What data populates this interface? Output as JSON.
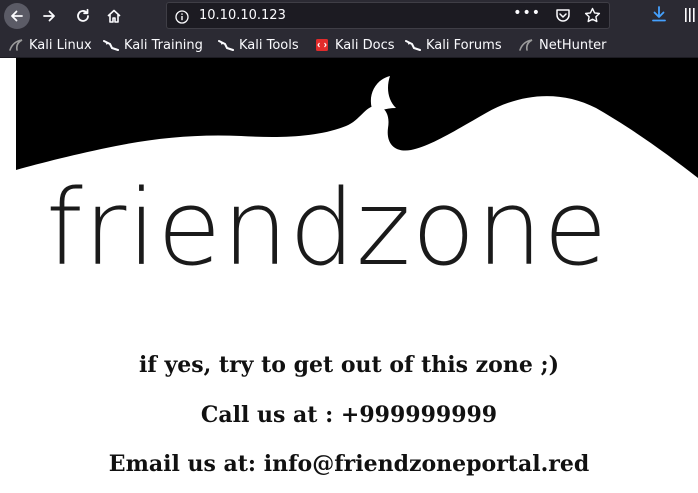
{
  "browser": {
    "url": "10.10.10.123",
    "more_label": "•••"
  },
  "bookmarks": [
    {
      "label": "Kali Linux",
      "icon": "kali-dragon-icon"
    },
    {
      "label": "Kali Training",
      "icon": "kali-dragon-icon"
    },
    {
      "label": "Kali Tools",
      "icon": "kali-dragon-icon"
    },
    {
      "label": "Kali Docs",
      "icon": "kali-docs-icon"
    },
    {
      "label": "Kali Forums",
      "icon": "kali-dragon-icon"
    },
    {
      "label": "NetHunter",
      "icon": "nethunter-icon"
    }
  ],
  "page": {
    "logo_text": "friendzone",
    "line1": "if yes, try to get out of this zone ;)",
    "line2": "Call us at : +999999999",
    "line3": "Email us at: info@friendzoneportal.red"
  },
  "colors": {
    "toolbar": "#2b2a33",
    "urlbar": "#1c1b22",
    "download_accent": "#45a1ff",
    "docs_red": "#e22b2b"
  }
}
